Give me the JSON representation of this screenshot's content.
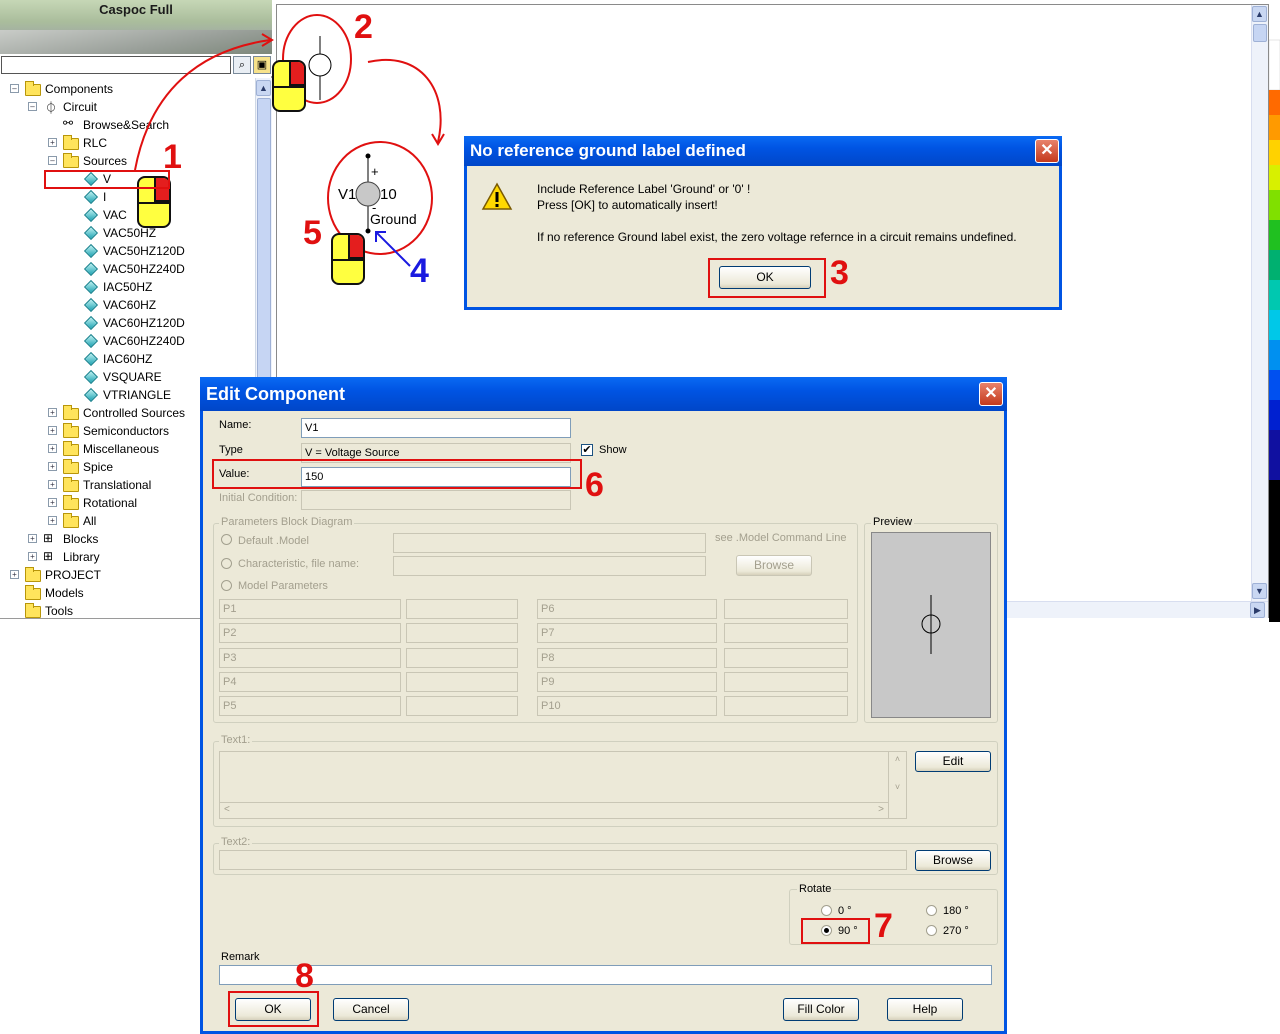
{
  "browser": {
    "title": "Caspoc Full",
    "tree": [
      {
        "label": "Components",
        "level": 0,
        "expander": "-",
        "icon": "folder"
      },
      {
        "label": "Circuit",
        "level": 1,
        "expander": "-",
        "icon": "circuit"
      },
      {
        "label": "Browse&Search",
        "level": 2,
        "expander": "",
        "icon": "binoculars"
      },
      {
        "label": "RLC",
        "level": 2,
        "expander": "+",
        "icon": "folder"
      },
      {
        "label": "Sources",
        "level": 2,
        "expander": "-",
        "icon": "folder"
      },
      {
        "label": "V",
        "level": 3,
        "expander": "",
        "icon": "gem"
      },
      {
        "label": "I",
        "level": 3,
        "expander": "",
        "icon": "gem"
      },
      {
        "label": "VAC",
        "level": 3,
        "expander": "",
        "icon": "gem"
      },
      {
        "label": "VAC50HZ",
        "level": 3,
        "expander": "",
        "icon": "gem"
      },
      {
        "label": "VAC50HZ120D",
        "level": 3,
        "expander": "",
        "icon": "gem"
      },
      {
        "label": "VAC50HZ240D",
        "level": 3,
        "expander": "",
        "icon": "gem"
      },
      {
        "label": "IAC50HZ",
        "level": 3,
        "expander": "",
        "icon": "gem"
      },
      {
        "label": "VAC60HZ",
        "level": 3,
        "expander": "",
        "icon": "gem"
      },
      {
        "label": "VAC60HZ120D",
        "level": 3,
        "expander": "",
        "icon": "gem"
      },
      {
        "label": "VAC60HZ240D",
        "level": 3,
        "expander": "",
        "icon": "gem"
      },
      {
        "label": "IAC60HZ",
        "level": 3,
        "expander": "",
        "icon": "gem"
      },
      {
        "label": "VSQUARE",
        "level": 3,
        "expander": "",
        "icon": "gem"
      },
      {
        "label": "VTRIANGLE",
        "level": 3,
        "expander": "",
        "icon": "gem"
      },
      {
        "label": "Controlled Sources",
        "level": 2,
        "expander": "+",
        "icon": "folder"
      },
      {
        "label": "Semiconductors",
        "level": 2,
        "expander": "+",
        "icon": "folder"
      },
      {
        "label": "Miscellaneous",
        "level": 2,
        "expander": "+",
        "icon": "folder"
      },
      {
        "label": "Spice",
        "level": 2,
        "expander": "+",
        "icon": "folder"
      },
      {
        "label": "Translational",
        "level": 2,
        "expander": "+",
        "icon": "folder"
      },
      {
        "label": "Rotational",
        "level": 2,
        "expander": "+",
        "icon": "folder"
      },
      {
        "label": "All",
        "level": 2,
        "expander": "+",
        "icon": "folder"
      },
      {
        "label": "Blocks",
        "level": 1,
        "expander": "+",
        "icon": "blocks"
      },
      {
        "label": "Library",
        "level": 1,
        "expander": "+",
        "icon": "blocks"
      },
      {
        "label": "PROJECT",
        "level": 0,
        "expander": "+",
        "icon": "folder"
      },
      {
        "label": "Models",
        "level": 0,
        "expander": "",
        "icon": "folder"
      },
      {
        "label": "Tools",
        "level": 0,
        "expander": "",
        "icon": "folder"
      }
    ]
  },
  "schematic": {
    "name_label": "V1",
    "value_label": "10",
    "plus": "+",
    "minus": "-",
    "ground_label": "Ground"
  },
  "warning_dialog": {
    "title": "No reference ground label defined",
    "line1": "Include Reference Label 'Ground' or '0' !",
    "line2": "Press [OK] to automatically insert!",
    "line3": "If no reference Ground label exist, the zero voltage refernce in a circuit remains undefined.",
    "ok_label": "OK",
    "close_label": "✕"
  },
  "edit_dialog": {
    "title": "Edit Component",
    "close_label": "✕",
    "name_label": "Name:",
    "name_value": "V1",
    "type_label": "Type",
    "type_value": "V = Voltage Source",
    "show_label": "Show",
    "show_checked": true,
    "value_label": "Value:",
    "value_value": "150",
    "initial_label": "Initial Condition:",
    "params_group": "Parameters Block Diagram",
    "default_model": "Default .Model",
    "see_model": "see .Model Command Line",
    "characteristic": "Characteristic, file name:",
    "browse1": "Browse",
    "model_params": "Model Parameters",
    "params_left": [
      "P1",
      "P2",
      "P3",
      "P4",
      "P5"
    ],
    "params_right": [
      "P6",
      "P7",
      "P8",
      "P9",
      "P10"
    ],
    "preview_label": "Preview",
    "text1_label": "Text1:",
    "edit_btn": "Edit",
    "text2_label": "Text2:",
    "browse2": "Browse",
    "rotate_label": "Rotate",
    "rot0": "0 °",
    "rot90": "90 °",
    "rot180": "180 °",
    "rot270": "270 °",
    "rotate_selected": "90 °",
    "remark_label": "Remark",
    "ok_label": "OK",
    "cancel_label": "Cancel",
    "fill_color_label": "Fill Color",
    "help_label": "Help"
  },
  "annotations": {
    "n1": "1",
    "n2": "2",
    "n3": "3",
    "n4": "4",
    "n5": "5",
    "n6": "6",
    "n7": "7",
    "n8": "8"
  },
  "colors": {
    "xp_title_blue": "#0054e3",
    "dialog_bg": "#ece9d8",
    "annotation_red": "#e01010",
    "annotation_blue": "#1a1ae0",
    "mouse_yellow": "#ffff40",
    "mouse_red": "#e41e1e"
  }
}
